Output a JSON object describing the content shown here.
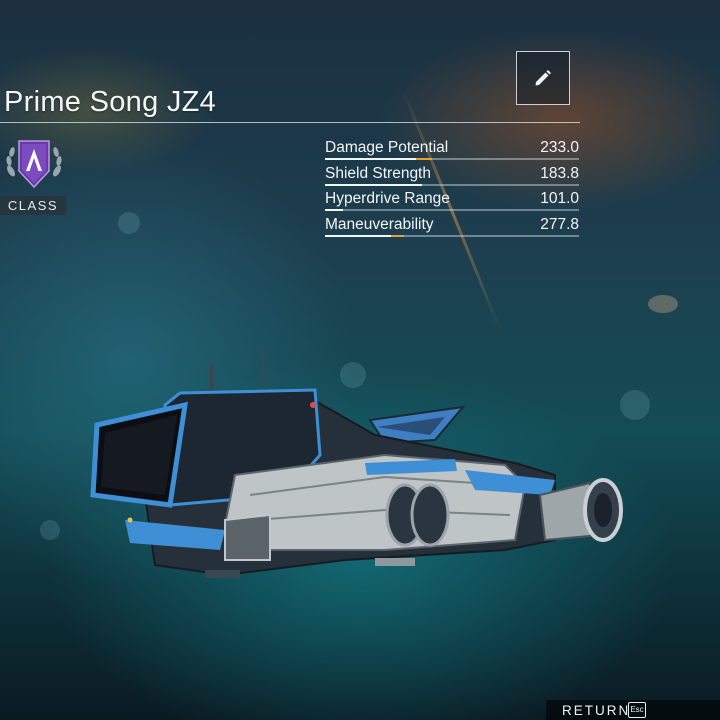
{
  "ship": {
    "name": "Prime Song JZ4",
    "class_label": "CLASS",
    "class_icon": "s-class-emblem-icon",
    "image": "starship-render"
  },
  "actions": {
    "edit_icon": "pencil-icon",
    "return_label": "RETURN",
    "return_key": "Esc"
  },
  "stats": [
    {
      "name": "Damage Potential",
      "value": "233.0",
      "fill": 0.36,
      "bonus": 0.06
    },
    {
      "name": "Shield Strength",
      "value": "183.8",
      "fill": 0.38,
      "bonus": 0.0
    },
    {
      "name": "Hyperdrive Range",
      "value": "101.0",
      "fill": 0.07,
      "bonus": 0.0
    },
    {
      "name": "Maneuverability",
      "value": "277.8",
      "fill": 0.26,
      "bonus": 0.05
    }
  ],
  "colors": {
    "accent_bonus": "#e8a12a",
    "class_purple": "#6a3aa8",
    "ship_blue": "#3f8fd6"
  }
}
